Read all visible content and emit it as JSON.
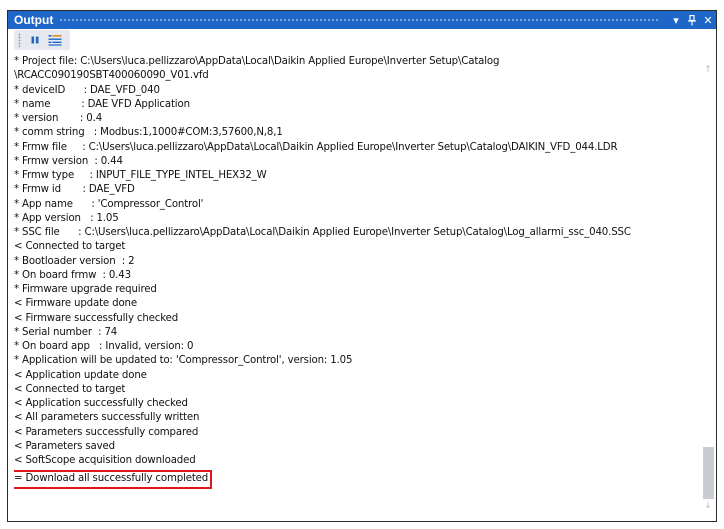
{
  "window": {
    "title": "Output",
    "dropdown_icon": "▾",
    "pin_icon": "ᵻ",
    "close_icon": "✕"
  },
  "toolbar": {
    "buttons": [
      "pause-icon",
      "word-wrap-icon"
    ]
  },
  "log_lines": [
    "* Project file: C:\\Users\\luca.pellizzaro\\AppData\\Local\\Daikin Applied Europe\\Inverter Setup\\Catalog",
    "\\RCACC090190SBT400060090_V01.vfd",
    "* deviceID      : DAE_VFD_040",
    "* name          : DAE VFD Application",
    "* version       : 0.4",
    "* comm string   : Modbus:1,1000#COM:3,57600,N,8,1",
    "* Frmw file     : C:\\Users\\luca.pellizzaro\\AppData\\Local\\Daikin Applied Europe\\Inverter Setup\\Catalog\\DAIKIN_VFD_044.LDR",
    "* Frmw version  : 0.44",
    "* Frmw type     : INPUT_FILE_TYPE_INTEL_HEX32_W",
    "* Frmw id       : DAE_VFD",
    "* App name      : 'Compressor_Control'",
    "* App version   : 1.05",
    "* SSC file      : C:\\Users\\luca.pellizzaro\\AppData\\Local\\Daikin Applied Europe\\Inverter Setup\\Catalog\\Log_allarmi_ssc_040.SSC",
    "< Connected to target",
    "* Bootloader version  : 2",
    "* On board frmw  : 0.43",
    "* Firmware upgrade required",
    "< Firmware update done",
    "< Firmware successfully checked",
    "* Serial number  : 74",
    "* On board app   : Invalid, version: 0",
    "* Application will be updated to: 'Compressor_Control', version: 1.05",
    "< Application update done",
    "< Connected to target",
    "< Application successfully checked",
    "< All parameters successfully written",
    "< Parameters successfully compared",
    "< Parameters saved",
    "< SoftScope acquisition downloaded"
  ],
  "final_line": "= Download all successfully completed",
  "colors": {
    "titlebar": "#1e66c8",
    "highlight_box": "#e0181c",
    "toolbar_icon": "#1e66c8"
  },
  "scrollbar": {
    "up_arrow": "↑",
    "down_arrow": "↓"
  }
}
